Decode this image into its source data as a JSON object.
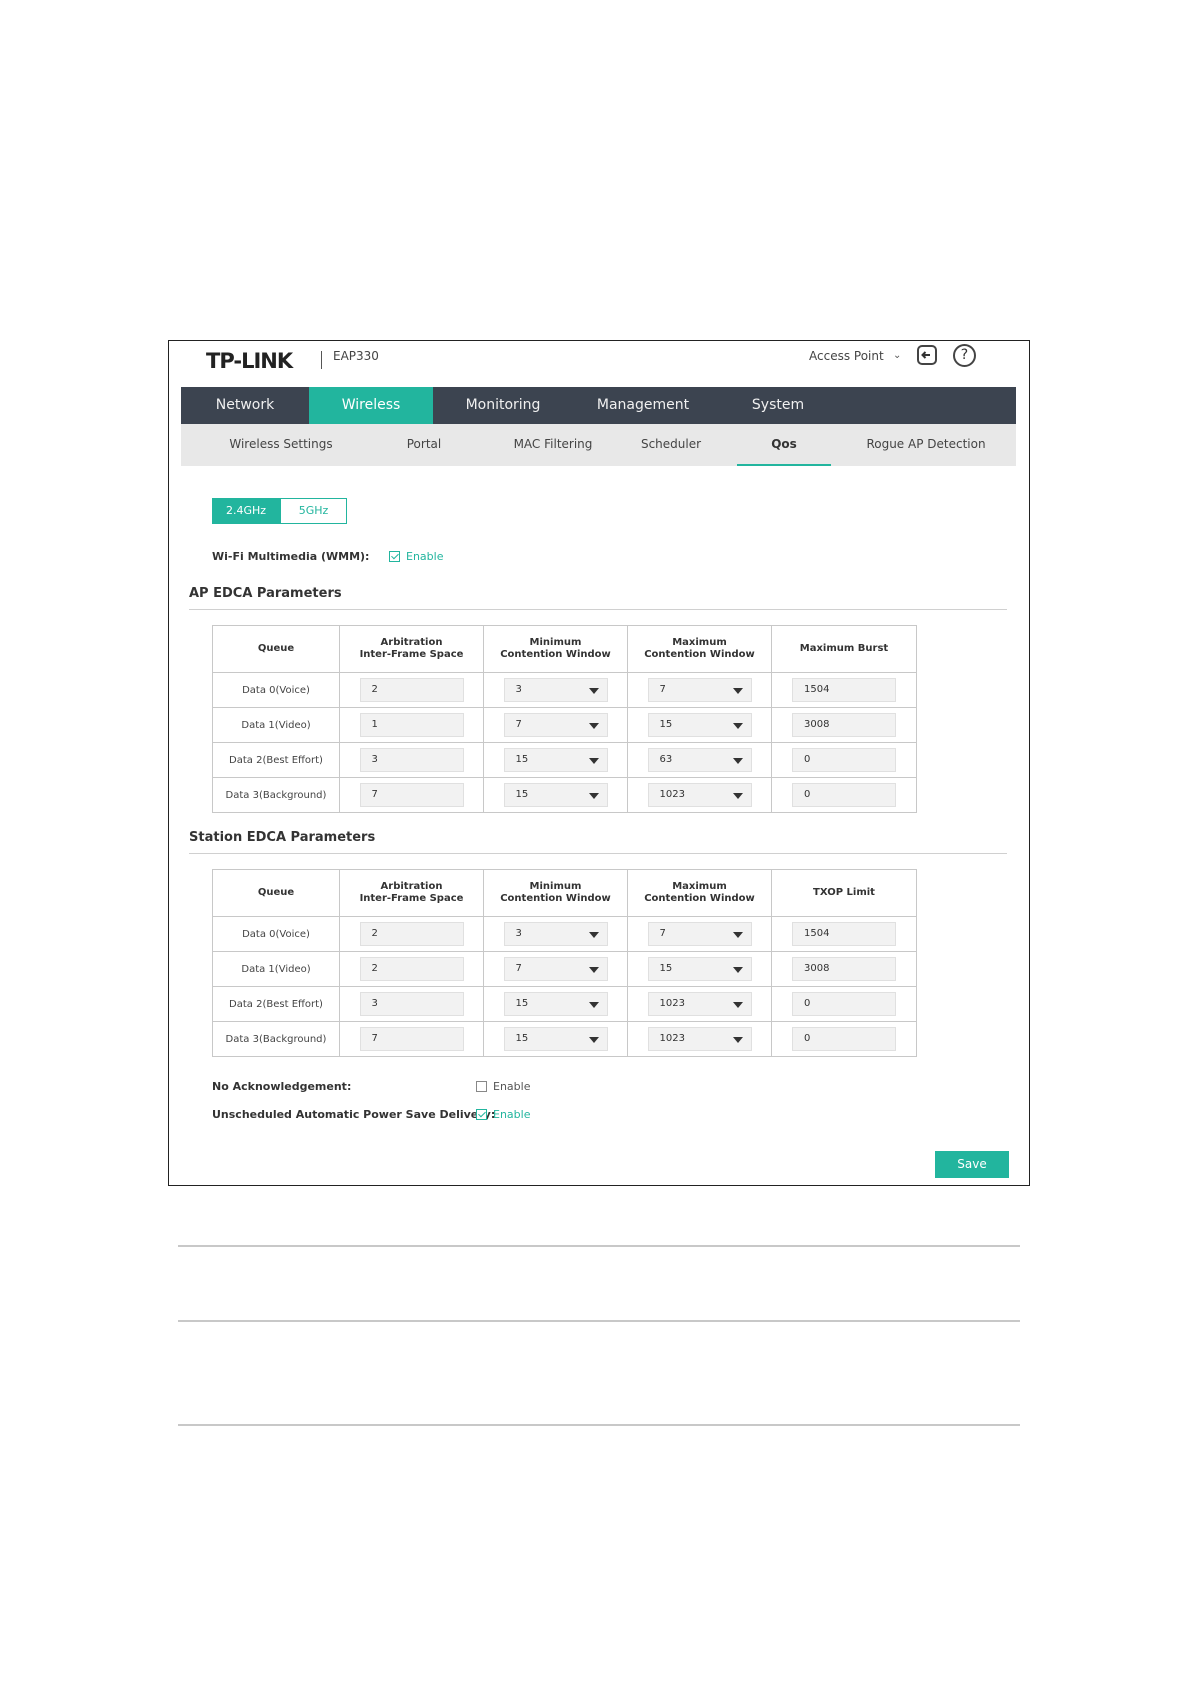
{
  "header": {
    "brand": "TP-LINK",
    "model": "EAP330",
    "mode": "Access Point",
    "help_glyph": "?",
    "icons": {
      "mode_caret": "chevron-down-icon",
      "logout": "logout-icon",
      "help": "help-icon"
    }
  },
  "main_nav": {
    "active": "Wireless",
    "items": [
      {
        "label": "Network"
      },
      {
        "label": "Wireless"
      },
      {
        "label": "Monitoring"
      },
      {
        "label": "Management"
      },
      {
        "label": "System"
      }
    ]
  },
  "sub_nav": {
    "active": "Qos",
    "items": [
      {
        "label": "Wireless Settings"
      },
      {
        "label": "Portal"
      },
      {
        "label": "MAC Filtering"
      },
      {
        "label": "Scheduler"
      },
      {
        "label": "Qos"
      },
      {
        "label": "Rogue AP Detection"
      }
    ]
  },
  "band_tabs": {
    "active": "2.4GHz",
    "items": [
      "2.4GHz",
      "5GHz"
    ]
  },
  "wmm": {
    "label": "Wi-Fi Multimedia (WMM):",
    "checked": true,
    "text": "Enable"
  },
  "ap_edca": {
    "title": "AP EDCA Parameters",
    "headers": [
      "Queue",
      "Arbitration\nInter-Frame Space",
      "Minimum\nContention Window",
      "Maximum\nContention Window",
      "Maximum Burst"
    ],
    "rows": [
      {
        "queue": "Data 0(Voice)",
        "aifs": "2",
        "cwmin": "3",
        "cwmax": "7",
        "last": "1504"
      },
      {
        "queue": "Data 1(Video)",
        "aifs": "1",
        "cwmin": "7",
        "cwmax": "15",
        "last": "3008"
      },
      {
        "queue": "Data 2(Best Effort)",
        "aifs": "3",
        "cwmin": "15",
        "cwmax": "63",
        "last": "0"
      },
      {
        "queue": "Data 3(Background)",
        "aifs": "7",
        "cwmin": "15",
        "cwmax": "1023",
        "last": "0"
      }
    ]
  },
  "station_edca": {
    "title": "Station EDCA Parameters",
    "headers": [
      "Queue",
      "Arbitration\nInter-Frame Space",
      "Minimum\nContention Window",
      "Maximum\nContention Window",
      "TXOP Limit"
    ],
    "rows": [
      {
        "queue": "Data 0(Voice)",
        "aifs": "2",
        "cwmin": "3",
        "cwmax": "7",
        "last": "1504"
      },
      {
        "queue": "Data 1(Video)",
        "aifs": "2",
        "cwmin": "7",
        "cwmax": "15",
        "last": "3008"
      },
      {
        "queue": "Data 2(Best Effort)",
        "aifs": "3",
        "cwmin": "15",
        "cwmax": "1023",
        "last": "0"
      },
      {
        "queue": "Data 3(Background)",
        "aifs": "7",
        "cwmin": "15",
        "cwmax": "1023",
        "last": "0"
      }
    ]
  },
  "no_ack": {
    "label": "No Acknowledgement:",
    "checked": false,
    "text": "Enable"
  },
  "uapsd": {
    "label": "Unscheduled Automatic Power Save Delivery:",
    "checked": true,
    "text": "Enable"
  },
  "save_label": "Save",
  "colors": {
    "accent": "#22b59e",
    "nav_bg": "#3c4450",
    "subnav_bg": "#e8e8e8"
  }
}
